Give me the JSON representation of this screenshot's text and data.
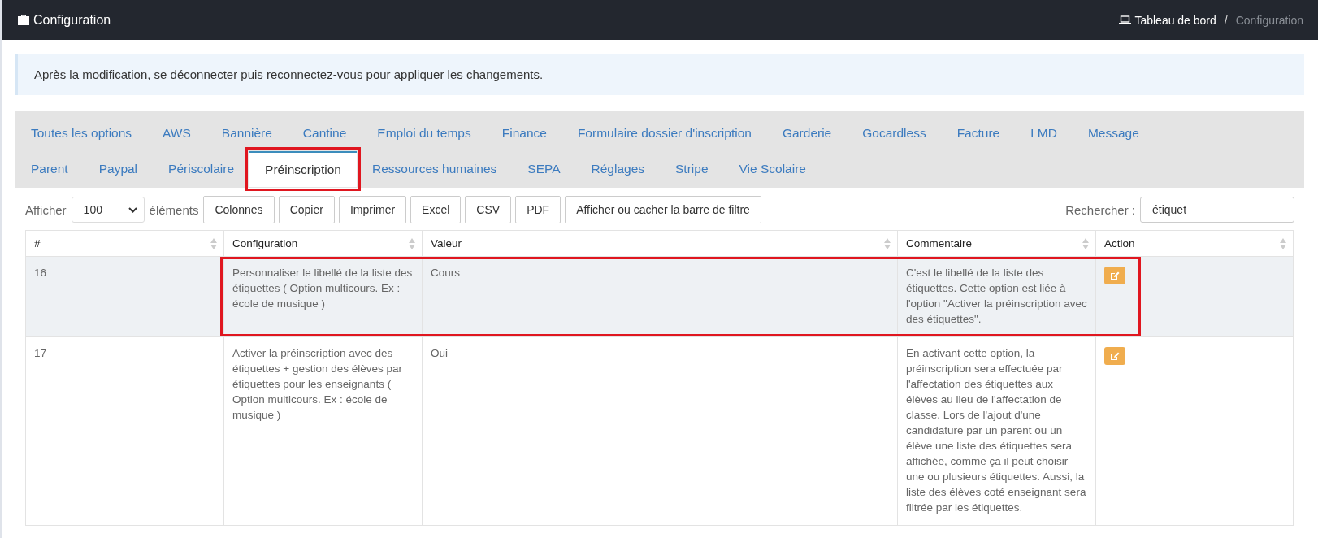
{
  "header": {
    "title": "Configuration",
    "breadcrumb": [
      {
        "label": "Tableau de bord",
        "kind": "link"
      },
      {
        "label": "/",
        "kind": "separator"
      },
      {
        "label": "Configuration",
        "kind": "current"
      }
    ]
  },
  "alert": "Après la modification, se déconnecter puis reconnectez-vous pour appliquer les changements.",
  "tabs": [
    {
      "label": "Toutes les options",
      "selected": false,
      "highlighted": false
    },
    {
      "label": "AWS",
      "selected": false,
      "highlighted": false
    },
    {
      "label": "Bannière",
      "selected": false,
      "highlighted": false
    },
    {
      "label": "Cantine",
      "selected": false,
      "highlighted": false
    },
    {
      "label": "Emploi du temps",
      "selected": false,
      "highlighted": false
    },
    {
      "label": "Finance",
      "selected": false,
      "highlighted": false
    },
    {
      "label": "Formulaire dossier d'inscription",
      "selected": false,
      "highlighted": false
    },
    {
      "label": "Garderie",
      "selected": false,
      "highlighted": false
    },
    {
      "label": "Gocardless",
      "selected": false,
      "highlighted": false
    },
    {
      "label": "Facture",
      "selected": false,
      "highlighted": false
    },
    {
      "label": "LMD",
      "selected": false,
      "highlighted": false
    },
    {
      "label": "Message",
      "selected": false,
      "highlighted": false
    },
    {
      "label": "Parent",
      "selected": false,
      "highlighted": false
    },
    {
      "label": "Paypal",
      "selected": false,
      "highlighted": false
    },
    {
      "label": "Périscolaire",
      "selected": false,
      "highlighted": false
    },
    {
      "label": "Préinscription",
      "selected": true,
      "highlighted": true
    },
    {
      "label": "Ressources humaines",
      "selected": false,
      "highlighted": false
    },
    {
      "label": "SEPA",
      "selected": false,
      "highlighted": false
    },
    {
      "label": "Réglages",
      "selected": false,
      "highlighted": false
    },
    {
      "label": "Stripe",
      "selected": false,
      "highlighted": false
    },
    {
      "label": "Vie Scolaire",
      "selected": false,
      "highlighted": false
    }
  ],
  "table_controls": {
    "show_label": "Afficher",
    "page_size": "100",
    "entries_label": "éléments",
    "buttons": [
      "Colonnes",
      "Copier",
      "Imprimer",
      "Excel",
      "CSV",
      "PDF",
      "Afficher ou cacher la barre de filtre"
    ],
    "search_label": "Rechercher :",
    "search_value": "étiquet"
  },
  "table": {
    "columns": [
      "#",
      "Configuration",
      "Valeur",
      "Commentaire",
      "Action"
    ],
    "rows": [
      {
        "cells": [
          "16",
          "Personnaliser le libellé de la liste des étiquettes ( Option multicours. Ex : école de musique )",
          "Cours",
          "C'est le libellé de la liste des étiquettes. Cette option est liée à l'option \"Activer la préinscription avec des étiquettes\"."
        ],
        "highlighted": true
      },
      {
        "cells": [
          "17",
          "Activer la préinscription avec des étiquettes + gestion des élèves par étiquettes pour les enseignants ( Option multicours. Ex : école de musique )",
          "Oui",
          "En activant cette option, la préinscription sera effectuée par l'affectation des étiquettes aux élèves au lieu de l'affectation de classe. Lors de l'ajout d'une candidature par un parent ou un élève une liste des étiquettes sera affichée, comme ça il peut choisir une ou plusieurs étiquettes. Aussi, la liste des élèves coté enseignant sera filtrée par les étiquettes."
        ],
        "highlighted": false
      }
    ]
  }
}
